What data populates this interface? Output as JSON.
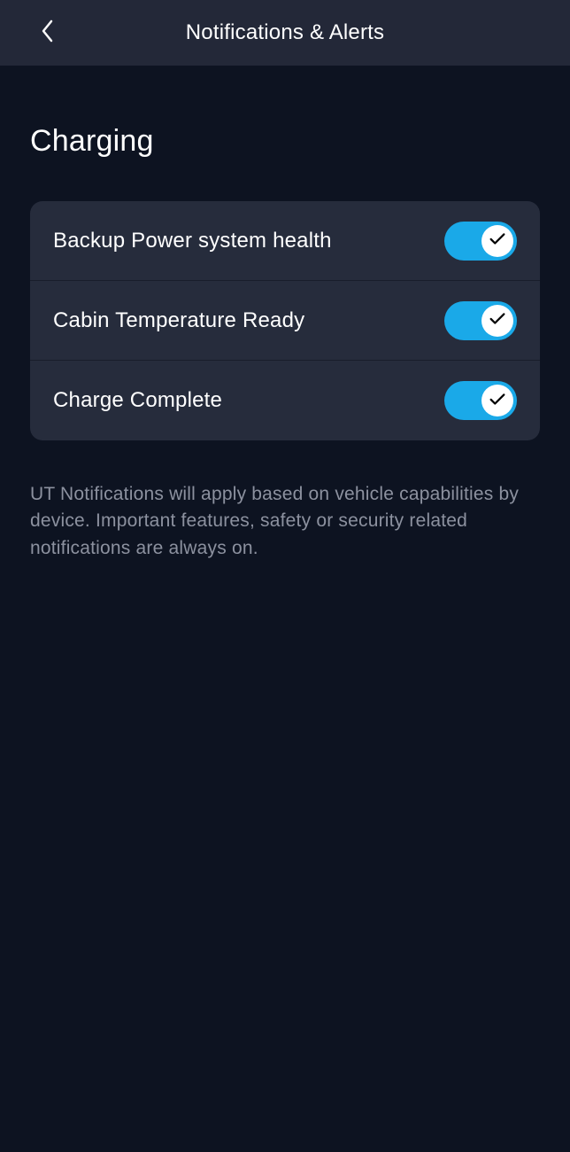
{
  "header": {
    "title": "Notifications & Alerts"
  },
  "section": {
    "title": "Charging"
  },
  "settings": [
    {
      "label": "Backup Power system health",
      "enabled": true
    },
    {
      "label": "Cabin Temperature Ready",
      "enabled": true
    },
    {
      "label": "Charge Complete",
      "enabled": true
    }
  ],
  "footer": {
    "note": "UT Notifications will apply based on vehicle capabilities by device. Important features, safety or security related notifications are always on."
  }
}
